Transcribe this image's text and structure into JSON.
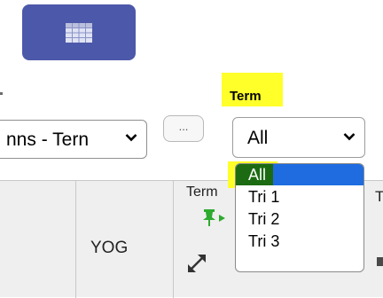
{
  "toolbar": {
    "table_icon": "table-grid-icon"
  },
  "columns_select": {
    "value": "nns - Tern"
  },
  "more_button": {
    "label": "..."
  },
  "term_filter": {
    "label": "Term",
    "value": "All",
    "options": [
      "All",
      "Tri 1",
      "Tri 2",
      "Tri 3"
    ],
    "selected_index": 0
  },
  "grid_header": {
    "columns": [
      "YOG",
      "Term",
      "T"
    ]
  },
  "colors": {
    "button_bg": "#4c58a9",
    "highlight": "#ffff29",
    "selected_option": "#1e6ce0",
    "pin_green": "#2eab2e"
  },
  "icons": [
    "table-grid-icon",
    "chevron-down-icon",
    "pin-icon",
    "arrow-right-icon",
    "expand-icon"
  ]
}
